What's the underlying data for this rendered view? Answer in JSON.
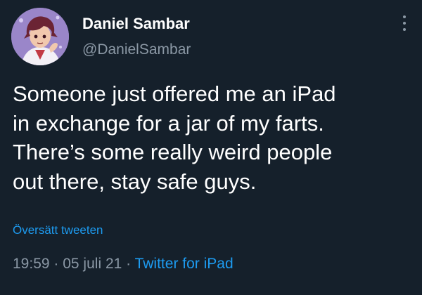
{
  "author": {
    "display_name": "Daniel Sambar",
    "handle": "@DanielSambar",
    "avatar_icon": "anime-character-avatar"
  },
  "tweet": {
    "lines": [
      "Someone just offered me an iPad",
      "in exchange for a jar of my farts.",
      "There’s some really weird people",
      "out there, stay safe guys."
    ],
    "translate_label": "Översätt tweeten",
    "time": "19:59",
    "separator": " · ",
    "date": "05 juli 21",
    "source": "Twitter for iPad"
  },
  "menu": {
    "icon": "more-vertical-icon"
  },
  "colors": {
    "background": "#15202b",
    "text": "#ffffff",
    "secondary_text": "#8b98a5",
    "link": "#1d9bf0"
  }
}
